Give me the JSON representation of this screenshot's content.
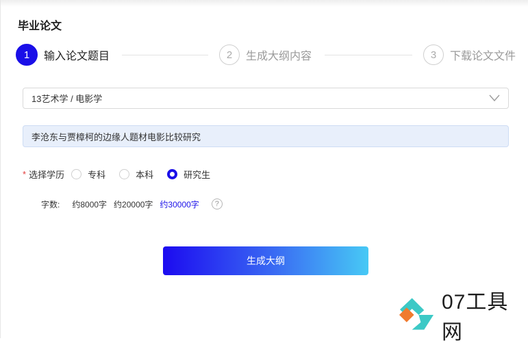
{
  "page": {
    "title": "毕业论文"
  },
  "steps": [
    {
      "number": "1",
      "label": "输入论文题目"
    },
    {
      "number": "2",
      "label": "生成大纲内容"
    },
    {
      "number": "3",
      "label": "下载论文文件"
    }
  ],
  "form": {
    "category": {
      "value": "13艺术学 / 电影学",
      "icon": "chevron-down-icon"
    },
    "topic": {
      "value": "李沧东与贾樟柯的边缘人题材电影比较研究"
    },
    "education": {
      "required_mark": "*",
      "label": "选择学历",
      "options": [
        "专科",
        "本科",
        "研究生"
      ],
      "selected": "研究生"
    },
    "word_count": {
      "label": "字数:",
      "options": [
        "约8000字",
        "约20000字",
        "约30000字"
      ],
      "selected": "约30000字",
      "help_icon": "question-circle-icon",
      "help_glyph": "?"
    },
    "submit_label": "生成大纲"
  },
  "watermark": {
    "text": "07工具网",
    "icon": "diamond-logo-icon"
  },
  "colors": {
    "primary": "#1a0fe8",
    "gradient_end": "#47c9f5",
    "input_bg": "#e8effb"
  }
}
